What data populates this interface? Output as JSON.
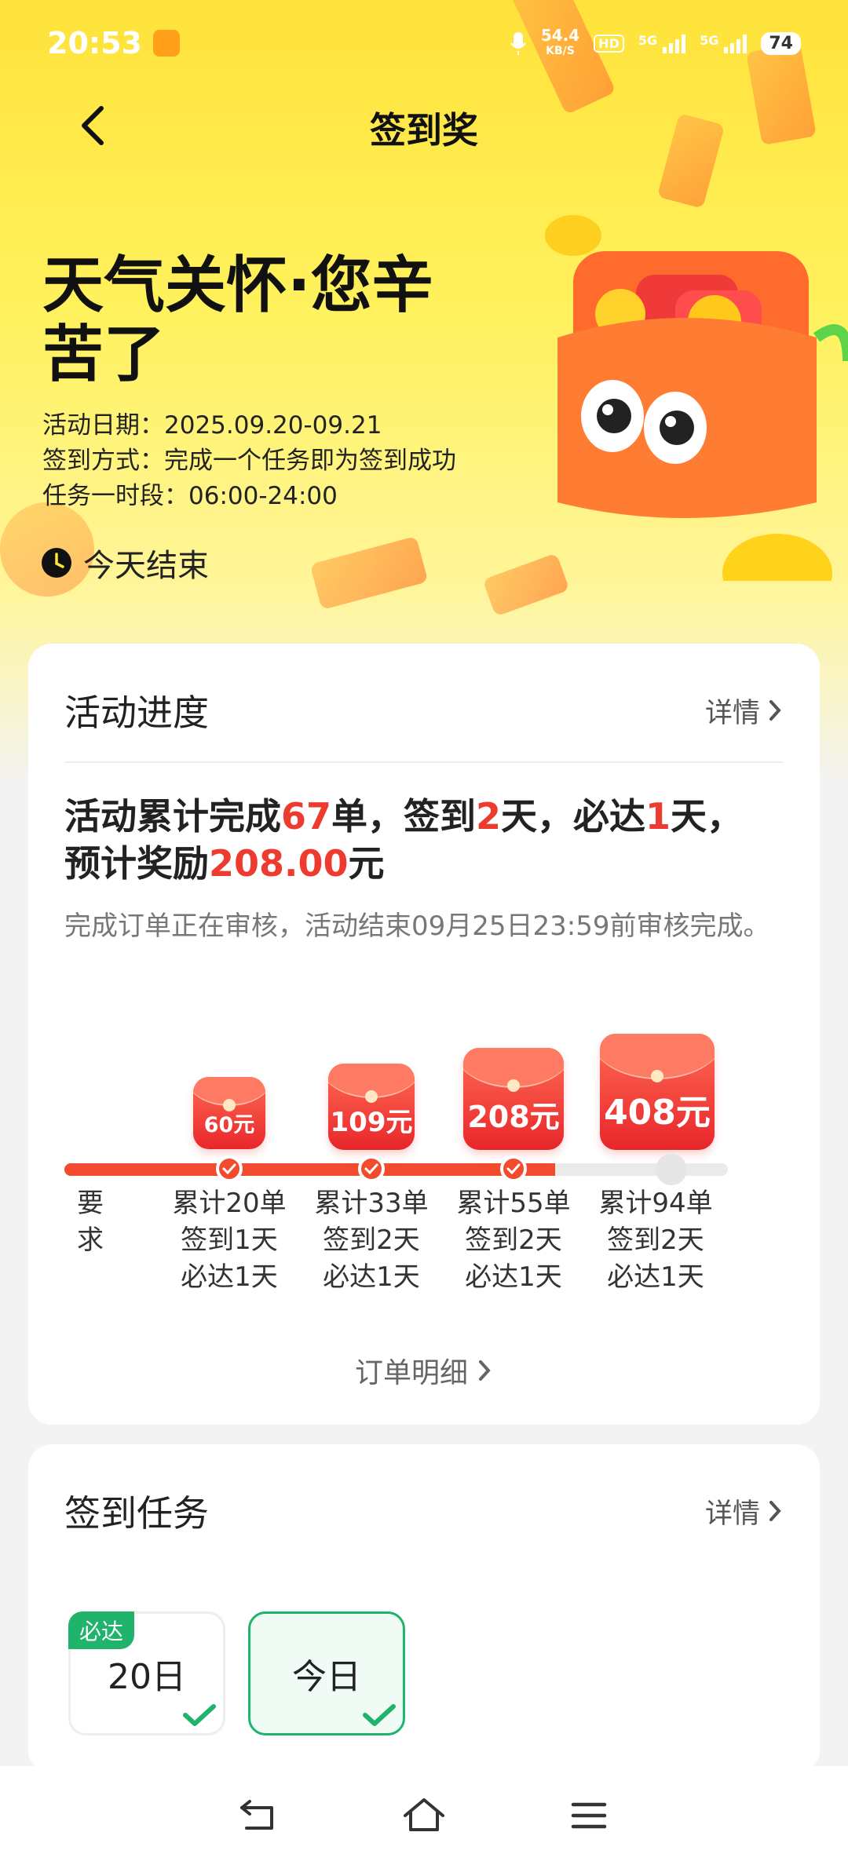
{
  "status_bar": {
    "time": "20:53",
    "speed_value": "54.4",
    "speed_unit": "KB/S",
    "net1": "5G",
    "net2": "5G",
    "hd": "HD",
    "battery": "74"
  },
  "header": {
    "title": "签到奖"
  },
  "hero": {
    "title": "天气关怀·您辛苦了",
    "date_line": "活动日期：2025.09.20-09.21",
    "method_line": "签到方式：完成一个任务即为签到成功",
    "period_line": "任务一时段：06:00-24:00",
    "ends": "今天结束"
  },
  "progress_card": {
    "title": "活动进度",
    "detail": "详情",
    "summary": {
      "p1": "活动累计完成",
      "orders": "67",
      "p2": "单，签到",
      "days": "2",
      "p3": "天，必达",
      "must": "1",
      "p4": "天，",
      "p5": "预计奖励",
      "reward": "208.00",
      "p6": "元"
    },
    "note": "完成订单正在审核，活动结束09月25日23:59前审核完成。",
    "cut_label": "要求",
    "fill_fraction": 0.74,
    "tiers": [
      {
        "amount": "60元",
        "orders": "累计20单",
        "sign": "签到1天",
        "must": "必达1天",
        "done": true
      },
      {
        "amount": "109元",
        "orders": "累计33单",
        "sign": "签到2天",
        "must": "必达1天",
        "done": true
      },
      {
        "amount": "208元",
        "orders": "累计55单",
        "sign": "签到2天",
        "must": "必达1天",
        "done": true
      },
      {
        "amount": "408元",
        "orders": "累计94单",
        "sign": "签到2天",
        "must": "必达1天",
        "done": false
      }
    ],
    "order_link": "订单明细"
  },
  "tasks_card": {
    "title": "签到任务",
    "detail": "详情",
    "days": [
      {
        "label": "20日",
        "tag": "必达",
        "checked": true
      },
      {
        "label": "今日",
        "checked": true
      }
    ]
  },
  "colors": {
    "accent_red": "#ee3b2f",
    "accent_green": "#1fb36b",
    "hero_yellow": "#ffe23a"
  }
}
